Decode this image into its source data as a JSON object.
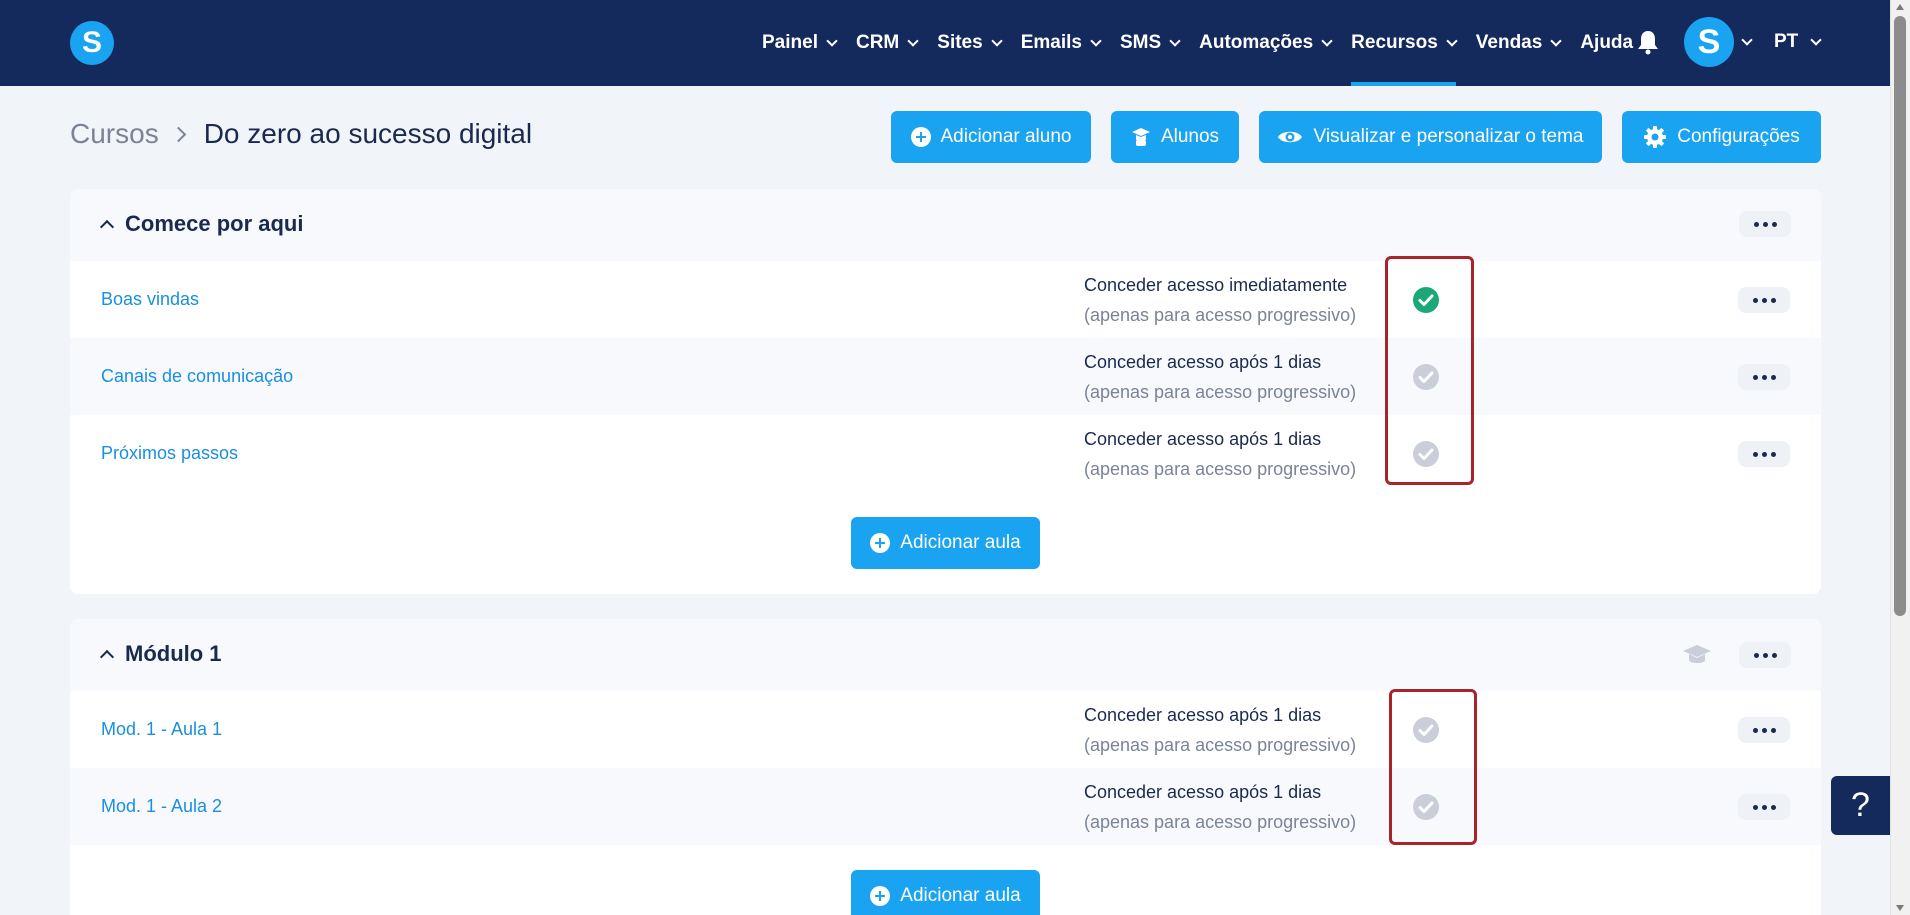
{
  "nav": {
    "logo": "S",
    "items": [
      {
        "label": "Painel",
        "active": false
      },
      {
        "label": "CRM",
        "active": false
      },
      {
        "label": "Sites",
        "active": false
      },
      {
        "label": "Emails",
        "active": false
      },
      {
        "label": "SMS",
        "active": false
      },
      {
        "label": "Automações",
        "active": false
      },
      {
        "label": "Recursos",
        "active": true
      },
      {
        "label": "Vendas",
        "active": false
      }
    ],
    "help": "Ajuda",
    "avatar": "S",
    "lang": "PT"
  },
  "breadcrumb": {
    "root": "Cursos",
    "current": "Do zero ao sucesso digital"
  },
  "toolbar": {
    "add_student": "Adicionar aluno",
    "students": "Alunos",
    "theme": "Visualizar e personalizar o tema",
    "settings": "Configurações"
  },
  "sections": [
    {
      "title": "Comece por aqui",
      "lessons": [
        {
          "title": "Boas vindas",
          "access": "Conceder acesso imediatamente",
          "note": "(apenas para acesso progressivo)",
          "checked": true
        },
        {
          "title": "Canais de comunicação",
          "access": "Conceder acesso após 1 dias",
          "note": "(apenas para acesso progressivo)",
          "checked": false
        },
        {
          "title": "Próximos passos",
          "access": "Conceder acesso após 1 dias",
          "note": "(apenas para acesso progressivo)",
          "checked": false
        }
      ],
      "add_label": "Adicionar aula"
    },
    {
      "title": "Módulo 1",
      "lessons": [
        {
          "title": "Mod. 1 - Aula 1",
          "access": "Conceder acesso após 1 dias",
          "note": "(apenas para acesso progressivo)",
          "checked": false
        },
        {
          "title": "Mod. 1 - Aula 2",
          "access": "Conceder acesso após 1 dias",
          "note": "(apenas para acesso progressivo)",
          "checked": false
        }
      ],
      "add_label": "Adicionar aula"
    }
  ],
  "help_button": "?",
  "colors": {
    "nav_bg": "#14295c",
    "accent": "#1aa3f0",
    "check_on": "#1aa876",
    "check_off": "#c9ced8",
    "highlight": "#a8242b"
  }
}
